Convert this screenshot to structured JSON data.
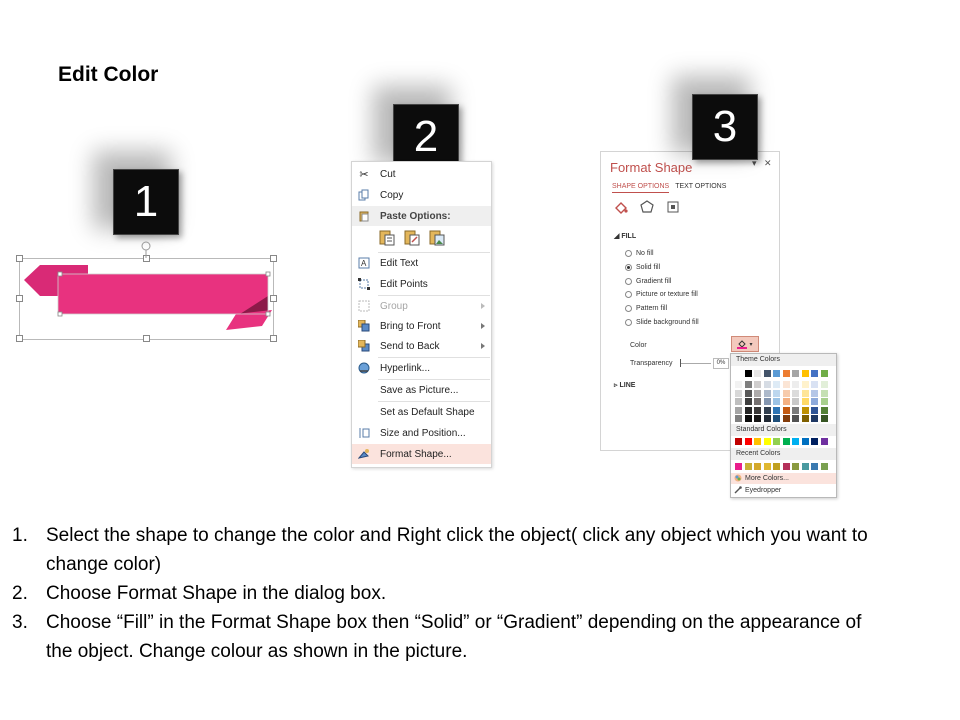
{
  "title": "Edit Color",
  "badges": [
    "1",
    "2",
    "3"
  ],
  "context_menu": {
    "items": [
      {
        "label": "Cut",
        "icon": "scissors-icon",
        "state": "normal"
      },
      {
        "label": "Copy",
        "icon": "copy-icon",
        "state": "normal"
      },
      {
        "label": "Paste Options:",
        "icon": "paste-icon",
        "state": "header"
      },
      {
        "label": "Edit Text",
        "icon": "edit-text-icon",
        "state": "normal"
      },
      {
        "label": "Edit Points",
        "icon": "edit-points-icon",
        "state": "normal"
      },
      {
        "label": "Group",
        "icon": "group-icon",
        "state": "disabled"
      },
      {
        "label": "Bring to Front",
        "icon": "bring-front-icon",
        "state": "normal"
      },
      {
        "label": "Send to Back",
        "icon": "send-back-icon",
        "state": "normal"
      },
      {
        "label": "Hyperlink...",
        "icon": "hyperlink-icon",
        "state": "normal"
      },
      {
        "label": "Save as Picture...",
        "icon": "",
        "state": "normal"
      },
      {
        "label": "Set as Default Shape",
        "icon": "",
        "state": "normal"
      },
      {
        "label": "Size and Position...",
        "icon": "size-icon",
        "state": "normal"
      },
      {
        "label": "Format Shape...",
        "icon": "format-shape-icon",
        "state": "highlighted"
      }
    ]
  },
  "format_pane": {
    "title": "Format Shape",
    "tabs": [
      "SHAPE OPTIONS",
      "TEXT OPTIONS"
    ],
    "fill_section": "FILL",
    "fill_options": [
      "No fill",
      "Solid fill",
      "Gradient fill",
      "Picture or texture fill",
      "Pattern fill",
      "Slide background fill"
    ],
    "selected_fill": "Solid fill",
    "color_label": "Color",
    "transparency_label": "Transparency",
    "transparency_value": "0%",
    "line_section": "LINE"
  },
  "color_dropdown": {
    "theme_label": "Theme Colors",
    "standard_label": "Standard Colors",
    "recent_label": "Recent Colors",
    "more_colors": "More Colors...",
    "eyedropper": "Eyedropper",
    "theme_top": [
      "#ffffff",
      "#000000",
      "#e7e6e6",
      "#44546a",
      "#5b9bd5",
      "#ed7d31",
      "#a5a5a5",
      "#ffc000",
      "#4472c4",
      "#70ad47"
    ],
    "theme_shades": [
      [
        "#f2f2f2",
        "#7f7f7f",
        "#d0cece",
        "#d6dce4",
        "#deebf6",
        "#fbe5d5",
        "#ededed",
        "#fff2cc",
        "#d9e2f3",
        "#e2efd9"
      ],
      [
        "#d8d8d8",
        "#595959",
        "#aeabab",
        "#adb9ca",
        "#bdd7ee",
        "#f7cbac",
        "#dbdbdb",
        "#fee599",
        "#b4c6e7",
        "#c5e0b3"
      ],
      [
        "#bfbfbf",
        "#3f3f3f",
        "#757070",
        "#8496b0",
        "#9cc3e5",
        "#f4b183",
        "#c9c9c9",
        "#ffd966",
        "#8eaadb",
        "#a8d08d"
      ],
      [
        "#a5a5a5",
        "#262626",
        "#3a3838",
        "#323f4f",
        "#2e75b5",
        "#c55a11",
        "#7b7b7b",
        "#bf9000",
        "#2f5496",
        "#538135"
      ],
      [
        "#7f7f7f",
        "#0c0c0c",
        "#171616",
        "#222a35",
        "#1e4e79",
        "#833c0b",
        "#525252",
        "#7f6000",
        "#1f3864",
        "#375623"
      ]
    ],
    "standard": [
      "#c00000",
      "#ff0000",
      "#ffc000",
      "#ffff00",
      "#92d050",
      "#00b050",
      "#00b0f0",
      "#0070c0",
      "#002060",
      "#7030a0"
    ],
    "recent": [
      "#e91e8c",
      "#c9b037",
      "#d4a82a",
      "#e0b830",
      "#c0a020",
      "#b5305a",
      "#8a9a40",
      "#4a9aa0",
      "#3a7ab0",
      "#7aa050"
    ]
  },
  "ribbon_color": "#e8327f",
  "instructions": [
    {
      "num": "1.",
      "text": "Select the shape to change the color and Right click the object( click any object which you want to change color)"
    },
    {
      "num": "2.",
      "text": "Choose Format Shape in the dialog box."
    },
    {
      "num": "3.",
      "text": "Choose “Fill” in the Format Shape box then “Solid” or “Gradient” depending on the appearance of the object. Change colour as shown in the picture."
    }
  ]
}
